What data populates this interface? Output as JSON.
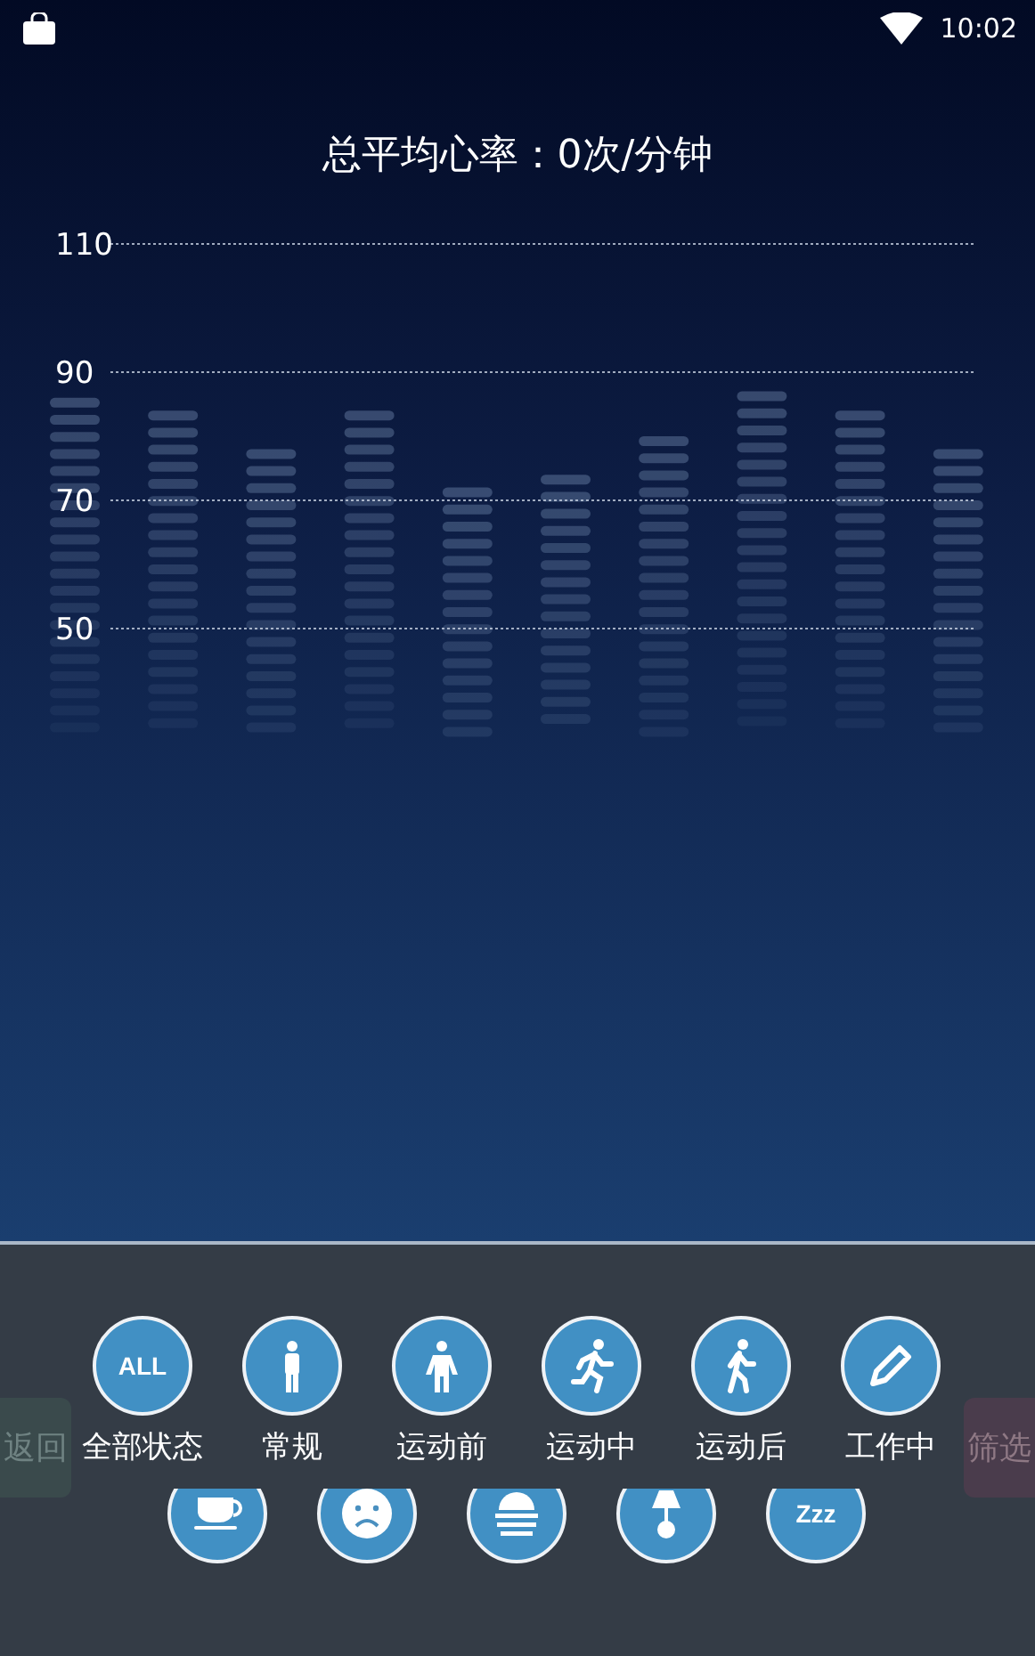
{
  "status_bar": {
    "time": "10:02"
  },
  "title": "总平均心率：0次/分钟",
  "chart": {
    "y_axis_labels": [
      "110",
      "90",
      "70",
      "50"
    ]
  },
  "background_buttons": [
    {
      "label": "返回",
      "kind": "back"
    },
    {
      "label": "筛选",
      "kind": "filter"
    }
  ],
  "states": [
    {
      "label": "全部状态",
      "kind": "all",
      "icon_text": "ALL"
    },
    {
      "label": "常规",
      "kind": "stand"
    },
    {
      "label": "运动前",
      "kind": "walk-ready"
    },
    {
      "label": "运动中",
      "kind": "run"
    },
    {
      "label": "运动后",
      "kind": "walk"
    },
    {
      "label": "工作中",
      "kind": "pencil"
    }
  ],
  "states_row_2": [
    {
      "kind": "cup"
    },
    {
      "kind": "sad"
    },
    {
      "kind": "sunrise"
    },
    {
      "kind": "lamp"
    },
    {
      "kind": "zzz",
      "icon_text": "Zzz"
    }
  ]
}
